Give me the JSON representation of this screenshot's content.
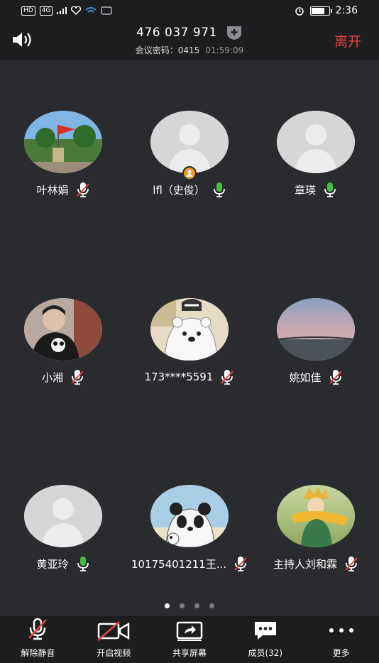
{
  "status_bar": {
    "indicators": [
      "HD",
      "4G",
      "signal",
      "heart",
      "wifi",
      "app"
    ],
    "time": "2:36",
    "battery_level": 0.75
  },
  "header": {
    "meeting_id": "476 037 971",
    "password_label": "会议密码：0415",
    "timer": "01:59:09",
    "leave_label": "离开"
  },
  "participants": [
    {
      "name": "叶林娟",
      "mic": "muted",
      "avatar": "photo-flag"
    },
    {
      "name": "lfl（史俊）",
      "mic": "active",
      "avatar": "default",
      "host": true
    },
    {
      "name": "章瑛",
      "mic": "active",
      "avatar": "default"
    },
    {
      "name": "小湘",
      "mic": "muted",
      "avatar": "photo-person"
    },
    {
      "name": "173****5591",
      "mic": "muted",
      "avatar": "cartoon-bear"
    },
    {
      "name": "姚如佳",
      "mic": "muted",
      "avatar": "photo-sky"
    },
    {
      "name": "黄亚玲",
      "mic": "active",
      "avatar": "default"
    },
    {
      "name": "10175401211王...",
      "mic": "muted",
      "avatar": "cartoon-panda"
    },
    {
      "name": "主持人刘和霖",
      "mic": "muted",
      "avatar": "photo-prince"
    }
  ],
  "pagination": {
    "pages": 4,
    "current": 1
  },
  "toolbar": {
    "unmute_label": "解除静音",
    "video_label": "开启视频",
    "share_label": "共享屏幕",
    "members_label": "成员(32)",
    "more_label": "更多"
  },
  "colors": {
    "background": "#2a2b2e",
    "bar": "#1c1d1f",
    "leave": "#e94345",
    "mic_active": "#3cc23c",
    "mic_muted_slash": "#e94345",
    "host_badge": "#f39a1c"
  }
}
